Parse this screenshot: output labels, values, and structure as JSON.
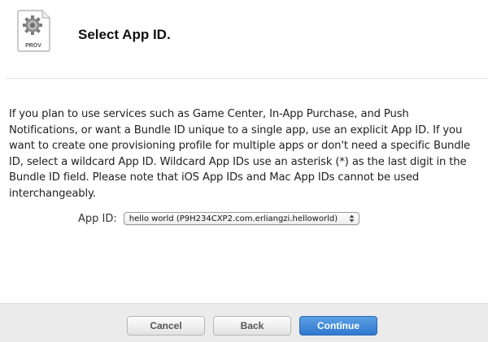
{
  "header": {
    "icon_label": "PROV",
    "icon_name": "provisioning-profile-icon",
    "title": "Select App ID."
  },
  "description": "If you plan to use services such as Game Center, In-App Purchase, and Push Notifications, or want a Bundle ID unique to a single app, use an explicit App ID. If you want to create one provisioning profile for multiple apps or don't need a specific Bundle ID, select a wildcard App ID. Wildcard App IDs use an asterisk (*) as the last digit in the Bundle ID field. Please note that iOS App IDs and Mac App IDs cannot be used interchangeably.",
  "app_id": {
    "label": "App ID:",
    "selected": "hello world (P9H234CXP2.com.erliangzi.helloworld)"
  },
  "footer": {
    "cancel_label": "Cancel",
    "back_label": "Back",
    "continue_label": "Continue"
  },
  "colors": {
    "primary_button": "#2f79d0",
    "footer_bg": "#ebebeb"
  }
}
